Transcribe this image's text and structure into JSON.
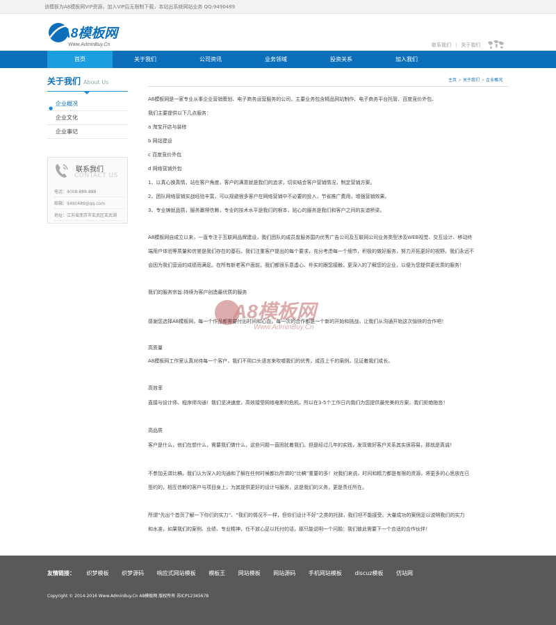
{
  "topbar": {
    "notice": "该模板为A8模板网VIP资源，加入VIP后无限制下载，本站出系统网站业务 QQ:9490489"
  },
  "header": {
    "logo_text": "A8模板网",
    "logo_sub": "Www.AdminBuy.Cn",
    "links": [
      "联系我们",
      "关于我们"
    ],
    "brand_color": "#0c6fbc"
  },
  "nav": {
    "items": [
      "首页",
      "关于我们",
      "公司资讯",
      "业务领域",
      "投资关系",
      "加入我们"
    ],
    "active_index": 0
  },
  "sidebar": {
    "title_cn": "关于我们",
    "title_en": "About Us",
    "menu": [
      "企业概况",
      "企业文化",
      "企业事记"
    ],
    "active_index": 0,
    "contact": {
      "title_cn": "联系我们",
      "title_en": "CONTACT US",
      "lines": [
        "电话：4008-888-888",
        "邮箱：9490489@qq.com",
        "地址：江苏省南京市玄武区玄武湖"
      ]
    }
  },
  "breadcrumb": [
    "主页",
    "关于我们",
    "企业概况"
  ],
  "content": {
    "paragraphs": [
      "A8模板网是一家专业从事企业营销策划、电子商务运营服务的公司，主要业务包含精品网站制作、电子商务平台托管、百度竞价外包、",
      "我们主要提供以下几点服务：",
      "a  淘宝开店与装修",
      "b  网站建设",
      "c  百度竞价外包",
      "d  网络营销外包",
      "1、以真心换真情，站在客户角度，客户的满意就是我们的追求，切实结合客户营销情况，制定营销方案。",
      "2、团队网络营销实战经验丰富，可以规避很多客户在网络营销中不必要的投入，节省推广费用，增强营销效果。",
      "3、专业铸就品质，服务赢得信赖，专业的技术水平是我们的根本，贴心的服务是我们和客户之间的友谊桥梁。",
      "A8模板网自成立以来，一直专注于互联网品牌建设，我们团队的成员曾服务国内优秀广告公司及互联网公司业务类型涉及WEB视觉、交互设计、移动终",
      "端用户体验等质量和信誉是我们存在的基石。我们注重客户提出的每个要求，充分考虑每一个细节，积极的做好服务，努力开拓更好的视野。我们永远不",
      "会因为我们营运的成绩而满足。在所有新老客户面前，我们都很乐意虚心、朴实的跟您接触，更深入的了解您的企业，以便为您提供更优质的服务！",
      "我们的服务宗旨:持续为客户创造最优质的服务",
      "感谢您选择A8模板网，每一个作品都需要付出时间和心血，每一次的合作都是一个新的开始和挑战，让我们从沟通开始这次愉快的合作吧！",
      "高质量",
      "A8模板网工作室认真对待每一个客户，我们不用口头语言来吹嘘我们的优秀，成百上千的案例，见证着我们成长。",
      "高效率",
      "直接与设计师、程序师沟通！我们坚决速度，高效接受网络电影的危机，所以在3-5个工作日内我们为您提供最完美的方案，我们拒绝拖沓！",
      "高品质",
      "客户是什么，他们在想什么，需要我们做什么，这些问题一直困扰着我们。但是经过几年的实践，发现做好客户关系其实很容易，那就是真诚！",
      "不参加无谓比稿，我们认为深入的沟通和了解在任何时候都比所谓的“比稿”重要的多！对我们来说，时间和精力都是有限的资源，将更多的心思放在已",
      "签约的，相互信赖的客户与项目身上，为其提供更好的设计与服务，这是我们的义务，更是责任所在。",
      "所谓“先出个首页了解一下你们的实力”、“我们的情况不一样，但你们设计不好”之类的托辞，我们坦不能接受。大量成功的案例足以说明我们的实力",
      "和水准，如果我们的案例、业绩、专业精神，任不放心足以托付的话，那只能说明一个问题：我们彼此需要下一个合适的合作伙伴！"
    ]
  },
  "watermark": {
    "text": "A8模板网",
    "sub": "Www.AdminBuy.Cn"
  },
  "footer": {
    "friend_label": "友情链接：",
    "friend_links": [
      "织梦模板",
      "织梦源码",
      "响应式网站模板",
      "模板王",
      "网站模板",
      "网站源码",
      "手机网站模板",
      "discuz模板",
      "仿站网"
    ],
    "copyright": "Copyright © 2014-2016 Www.AdminBuy.Cn A8模板网 版权所有 苏ICP12345678"
  }
}
